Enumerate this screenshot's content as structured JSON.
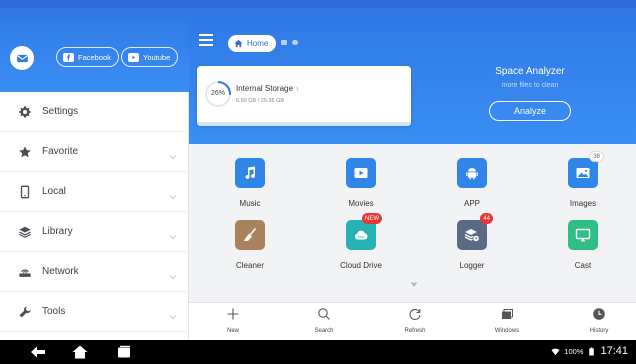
{
  "sidebar": {
    "social": {
      "facebook": "Facebook",
      "youtube": "Youtube"
    },
    "items": [
      {
        "label": "Settings",
        "icon": "gear-icon"
      },
      {
        "label": "Favorite",
        "icon": "star-icon"
      },
      {
        "label": "Local",
        "icon": "phone-icon"
      },
      {
        "label": "Library",
        "icon": "stack-icon"
      },
      {
        "label": "Network",
        "icon": "router-icon"
      },
      {
        "label": "Tools",
        "icon": "wrench-icon"
      }
    ]
  },
  "header": {
    "breadcrumb": "Home",
    "storage": {
      "title": "Internal Storage",
      "percent": "26%",
      "size": "6.50 GB / 25.36 GB"
    },
    "space_analyzer": {
      "title": "Space Analyzer",
      "subtitle": "more files to clean",
      "button": "Analyze"
    }
  },
  "grid": {
    "tiles": [
      {
        "label": "Music",
        "icon": "music-note-icon",
        "color": "#2f86e6"
      },
      {
        "label": "Movies",
        "icon": "play-icon",
        "color": "#2f86e6"
      },
      {
        "label": "APP",
        "icon": "android-icon",
        "color": "#2f86e6"
      },
      {
        "label": "Images",
        "icon": "image-icon",
        "color": "#2f86e6",
        "badge": "38"
      },
      {
        "label": "Cleaner",
        "icon": "broom-icon",
        "color": "#a9825e"
      },
      {
        "label": "Cloud Drive",
        "icon": "cloud-icon",
        "color": "#27b3b3",
        "badge": "NEW"
      },
      {
        "label": "Logger",
        "icon": "logger-icon",
        "color": "#5a6a86",
        "badge": "44"
      },
      {
        "label": "Cast",
        "icon": "cast-icon",
        "color": "#2fbf86"
      }
    ]
  },
  "toolbar": {
    "items": [
      {
        "label": "New",
        "icon": "plus-icon"
      },
      {
        "label": "Search",
        "icon": "search-icon"
      },
      {
        "label": "Refresh",
        "icon": "refresh-icon"
      },
      {
        "label": "Windows",
        "icon": "windows-icon"
      },
      {
        "label": "History",
        "icon": "history-icon"
      }
    ]
  },
  "system": {
    "battery": "100%",
    "time": "17:41"
  },
  "colors": {
    "accent": "#2f78e6",
    "badge": "#e53935"
  }
}
